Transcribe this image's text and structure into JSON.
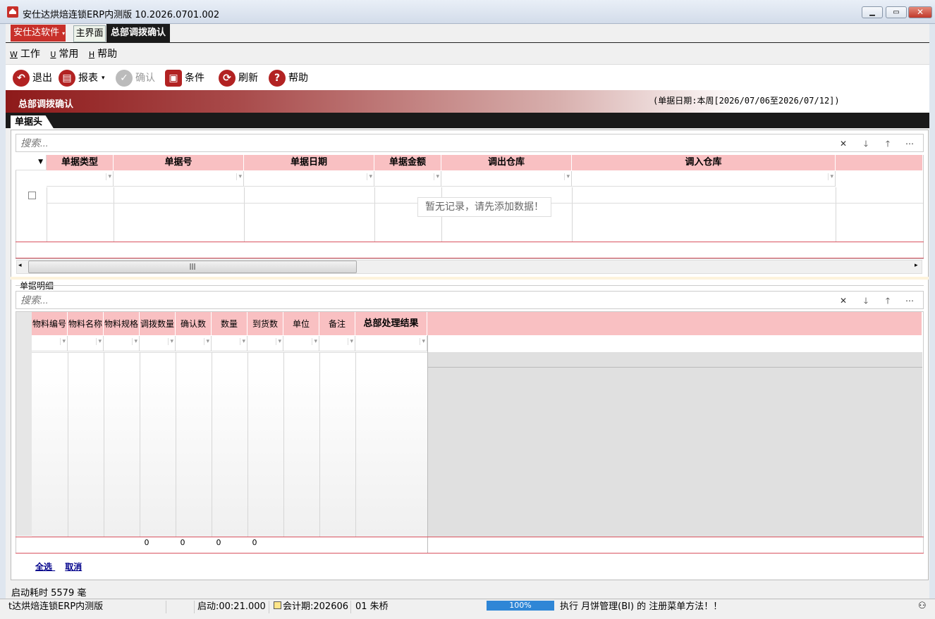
{
  "window": {
    "title": "安仕达烘焙连锁ERP内测版   10.2026.0701.002"
  },
  "brand_menu": "安仕达软件",
  "tabs": [
    {
      "label": "主界面"
    },
    {
      "label": "总部调拨确认"
    }
  ],
  "menubar": [
    {
      "key": "W",
      "label": "工作"
    },
    {
      "key": "U",
      "label": "常用"
    },
    {
      "key": "H",
      "label": "帮助"
    }
  ],
  "toolbar": {
    "exit": "退出",
    "report": "报表",
    "confirm": "确认",
    "condition": "条件",
    "refresh": "刷新",
    "help": "帮助"
  },
  "banner": {
    "title": "总部调拨确认",
    "range": "(单据日期:本周[2026/07/06至2026/07/12])"
  },
  "header_section": {
    "tab": "单据头",
    "search_placeholder": "搜索...",
    "columns": [
      "单据类型",
      "单据号",
      "单据日期",
      "单据金额",
      "调出仓库",
      "调入仓库"
    ],
    "empty_message": "暂无记录，请先添加数据！"
  },
  "detail_section": {
    "label": "单据明细",
    "search_placeholder": "搜索...",
    "columns": [
      "物料编号",
      "物料名称",
      "物料规格",
      "调拨数量",
      "确认数",
      "数量",
      "到货数",
      "单位",
      "备注",
      "总部处理结果"
    ],
    "totals": [
      "0",
      "0",
      "0",
      "0"
    ]
  },
  "footer_links": {
    "select_all": "全选",
    "cancel": "取消"
  },
  "startup_time": "启动耗时  5579  毫",
  "statusbar": {
    "app": "t达烘焙连锁ERP内测版",
    "boot": "启动:00:21.000",
    "period": "会计期:202606",
    "user": "01 朱桥",
    "progress": "100%",
    "message": "执行 月饼管理(BI) 的 注册菜单方法！！"
  }
}
